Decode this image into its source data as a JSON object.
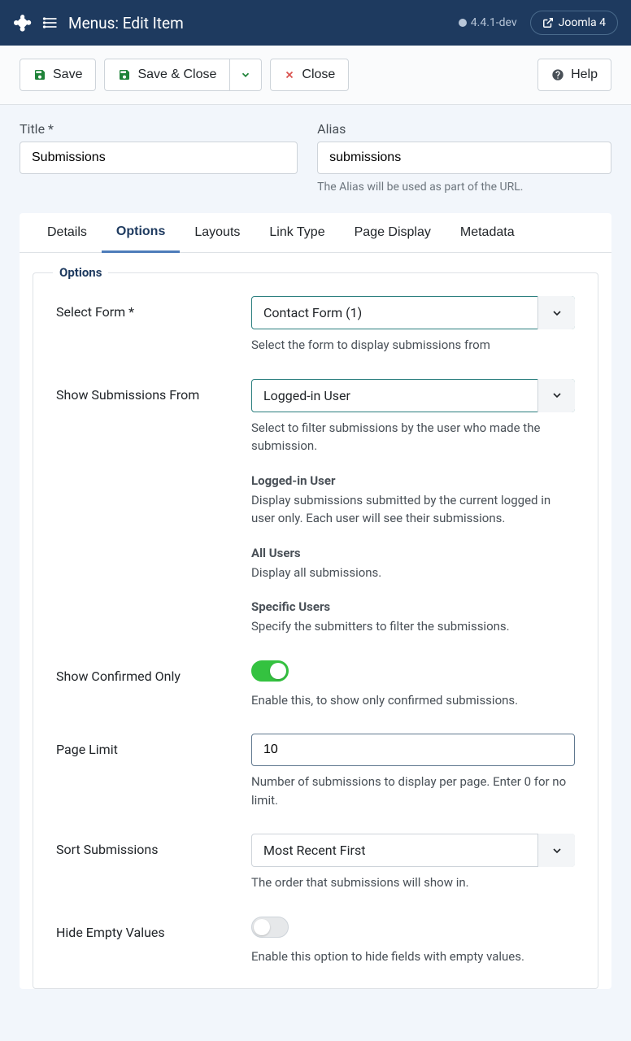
{
  "header": {
    "title": "Menus: Edit Item",
    "version": "4.4.1-dev",
    "joomla_btn": "Joomla 4"
  },
  "toolbar": {
    "save": "Save",
    "save_close": "Save & Close",
    "close": "Close",
    "help": "Help"
  },
  "fields": {
    "title_label": "Title *",
    "title_value": "Submissions",
    "alias_label": "Alias",
    "alias_value": "submissions",
    "alias_desc": "The Alias will be used as part of the URL."
  },
  "tabs": {
    "details": "Details",
    "options": "Options",
    "layouts": "Layouts",
    "link_type": "Link Type",
    "page_display": "Page Display",
    "metadata": "Metadata"
  },
  "legend": "Options",
  "form": {
    "select_form": {
      "label": "Select Form *",
      "value": "Contact Form (1)",
      "desc": "Select the form to display submissions from"
    },
    "show_from": {
      "label": "Show Submissions From",
      "value": "Logged-in User",
      "desc": "Select to filter submissions by the user who made the submission.",
      "sections": {
        "logged": {
          "title": "Logged-in User",
          "body": "Display submissions submitted by the current logged in user only. Each user will see their submissions."
        },
        "all": {
          "title": "All Users",
          "body": "Display all submissions."
        },
        "specific": {
          "title": "Specific Users",
          "body": "Specify the submitters to filter the submissions."
        }
      }
    },
    "confirmed": {
      "label": "Show Confirmed Only",
      "desc": "Enable this, to show only confirmed submissions."
    },
    "page_limit": {
      "label": "Page Limit",
      "value": "10",
      "desc": "Number of submissions to display per page. Enter 0 for no limit."
    },
    "sort": {
      "label": "Sort Submissions",
      "value": "Most Recent First",
      "desc": "The order that submissions will show in."
    },
    "hide_empty": {
      "label": "Hide Empty Values",
      "desc": "Enable this option to hide fields with empty values."
    }
  }
}
